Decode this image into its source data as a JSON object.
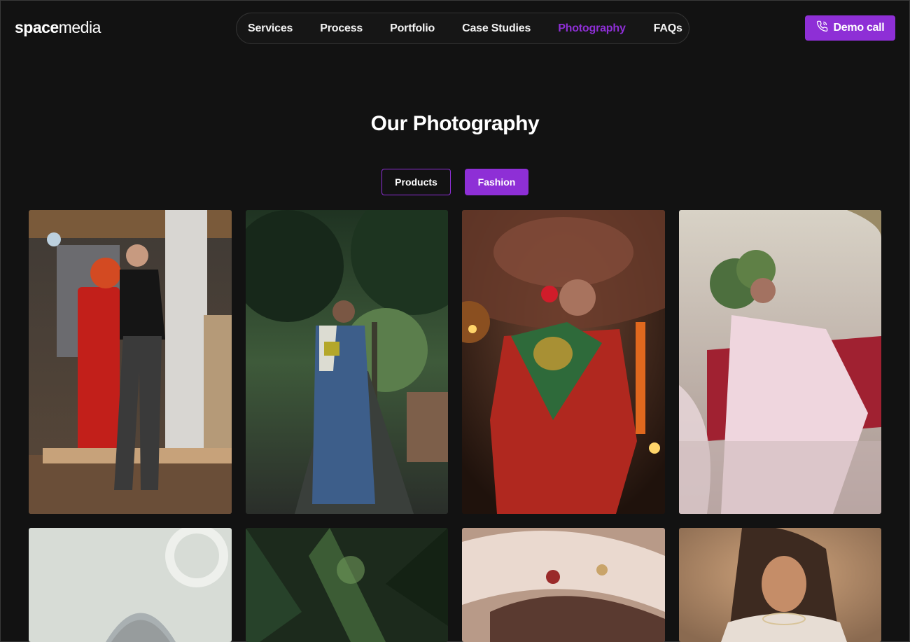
{
  "brand": {
    "part1": "space",
    "part2": "media"
  },
  "nav": {
    "items": [
      {
        "label": "Services"
      },
      {
        "label": "Process"
      },
      {
        "label": "Portfolio"
      },
      {
        "label": "Case Studies"
      },
      {
        "label": "Photography"
      },
      {
        "label": "FAQs"
      }
    ],
    "active": "Photography"
  },
  "cta": {
    "label": "Demo call",
    "icon": "phone-call-icon"
  },
  "page": {
    "title": "Our Photography"
  },
  "filters": {
    "items": [
      {
        "label": "Products"
      },
      {
        "label": "Fashion"
      }
    ],
    "active": "Fashion"
  },
  "colors": {
    "accent": "#8e2fd6",
    "background": "#121212",
    "text": "#ffffff"
  },
  "gallery": {
    "photos": [
      {
        "alt": "model-black-top-grey-jeans-red-fuel-pump"
      },
      {
        "alt": "woman-blue-saree-garden-path"
      },
      {
        "alt": "woman-red-saree-candles-gold-jewelry"
      },
      {
        "alt": "woman-pink-saree-seated"
      },
      {
        "alt": "woman-veil-white-background"
      },
      {
        "alt": "palm-foliage"
      },
      {
        "alt": "embroidered-fabric-closeup"
      },
      {
        "alt": "woman-portrait-warm-light"
      }
    ]
  }
}
